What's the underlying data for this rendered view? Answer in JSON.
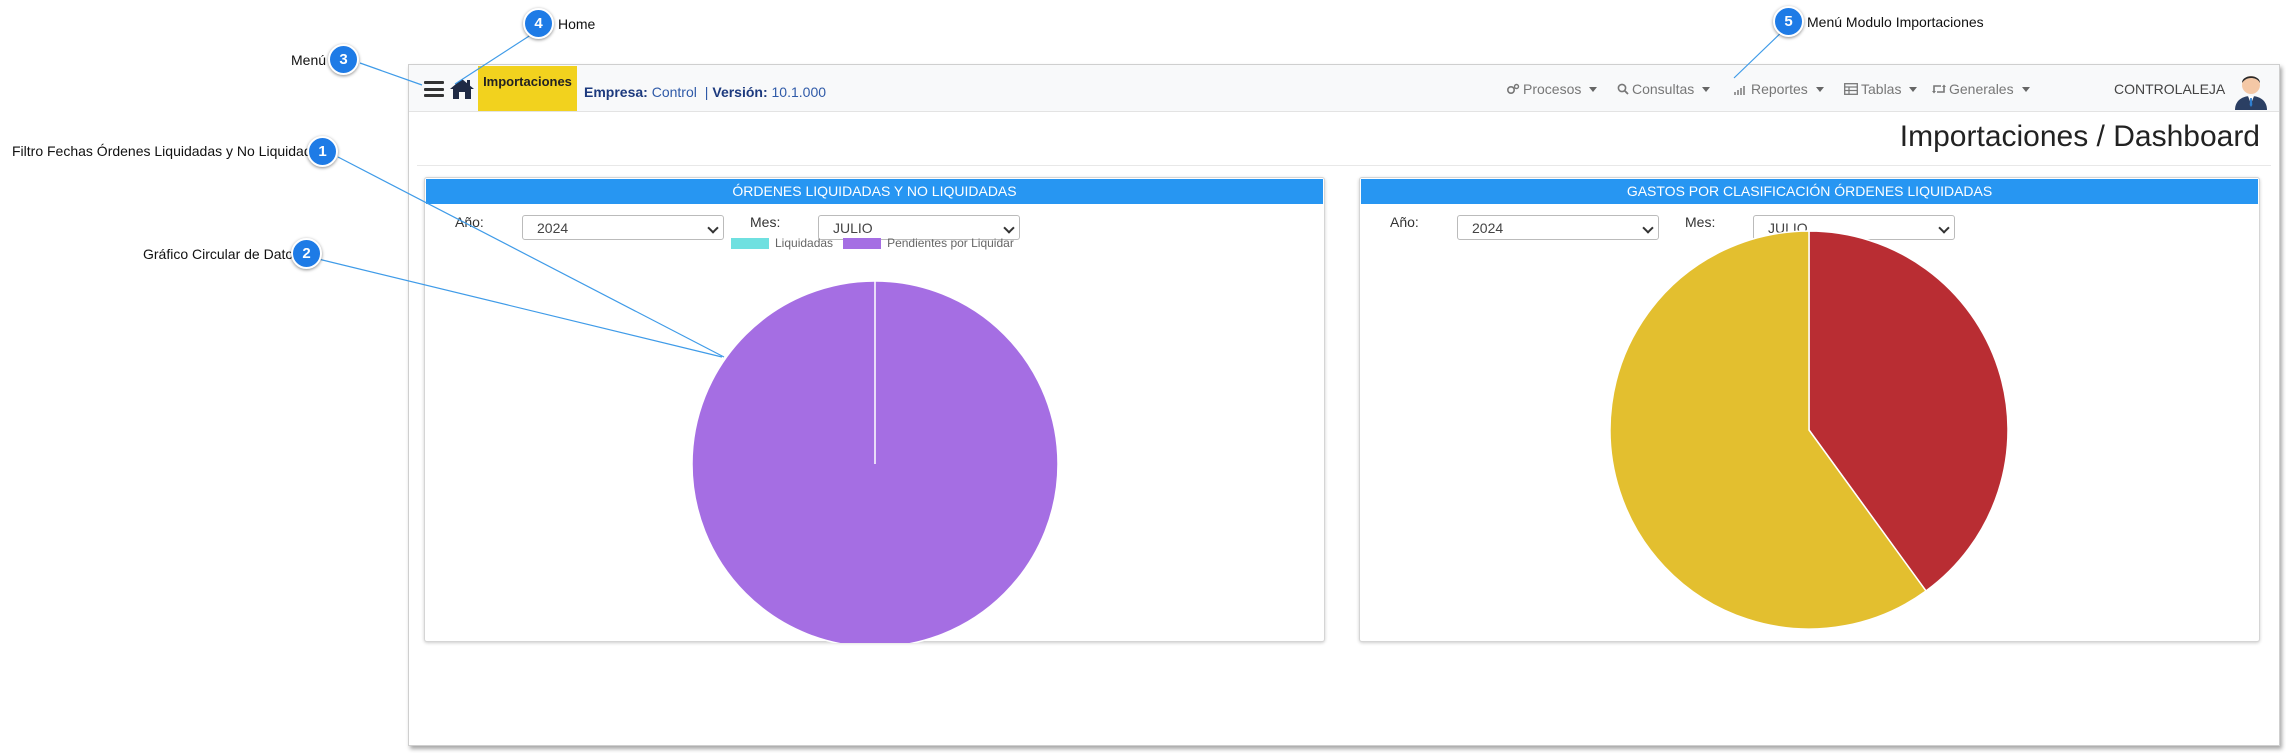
{
  "annotations": [
    {
      "number": "1",
      "label": "Filtro Fechas Órdenes Liquidadas y No Liquidadas"
    },
    {
      "number": "2",
      "label": "Gráfico Circular de Datos"
    },
    {
      "number": "3",
      "label": "Menú"
    },
    {
      "number": "4",
      "label": "Home"
    },
    {
      "number": "5",
      "label": "Menú Modulo Importaciones"
    }
  ],
  "navbar": {
    "module_badge": "Importaciones",
    "company_label": "Empresa:",
    "company_value": "Control",
    "separator": "|",
    "version_label": "Versión:",
    "version_value": "10.1.000",
    "menus": [
      {
        "label": "Procesos",
        "icon": "gears-icon"
      },
      {
        "label": "Consultas",
        "icon": "search-icon"
      },
      {
        "label": "Reportes",
        "icon": "signal-bars-icon"
      },
      {
        "label": "Tablas",
        "icon": "table-icon"
      },
      {
        "label": "Generales",
        "icon": "retweet-icon"
      }
    ],
    "username": "CONTROLALEJA"
  },
  "page": {
    "title": "Importaciones / Dashboard"
  },
  "panels": [
    {
      "header": "ÓRDENES LIQUIDADAS Y NO LIQUIDADAS",
      "year_label": "Año:",
      "year_value": "2024",
      "month_label": "Mes:",
      "month_value": "JULIO",
      "legend": [
        {
          "label": "Liquidadas",
          "color": "#6fe0e0"
        },
        {
          "label": "Pendientes por Liquidar",
          "color": "#a56ee3"
        }
      ]
    },
    {
      "header": "GASTOS POR CLASIFICACIÓN ÓRDENES LIQUIDADAS",
      "year_label": "Año:",
      "year_value": "2024",
      "month_label": "Mes:",
      "month_value": "JULIO"
    }
  ],
  "chart_data": [
    {
      "type": "pie",
      "categories": [
        "Liquidadas",
        "Pendientes por Liquidar"
      ],
      "values": [
        0,
        100
      ],
      "colors": [
        "#6fe0e0",
        "#a56ee3"
      ],
      "legend": "top"
    },
    {
      "type": "pie",
      "values": [
        40,
        60
      ],
      "colors": [
        "#b92d33",
        "#e3bf2f"
      ],
      "legend": "none"
    }
  ]
}
